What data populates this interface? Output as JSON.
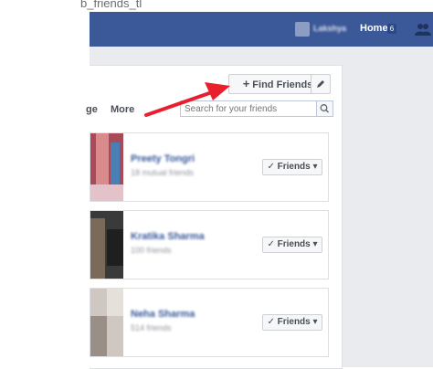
{
  "caption": "b_friends_tl",
  "topbar": {
    "username": "Lakshya",
    "home_label": "Home",
    "home_count": "6",
    "friend_requests_icon": "friend-requests-icon",
    "color": "#3b5998"
  },
  "toolbar": {
    "find_friends_label": "Find Friends",
    "find_friends_icon": "plus-icon",
    "edit_icon": "pencil-icon"
  },
  "tabs": {
    "partial_label": "ge",
    "more_label": "More"
  },
  "search": {
    "placeholder": "Search for your friends",
    "icon": "search-icon"
  },
  "friends": [
    {
      "name": "Preety Tongri",
      "meta": "18 mutual friends",
      "button_label": "Friends"
    },
    {
      "name": "Kratika Sharma",
      "meta": "100 friends",
      "button_label": "Friends"
    },
    {
      "name": "Neha Sharma",
      "meta": "514 friends",
      "button_label": "Friends"
    }
  ],
  "annotation": {
    "type": "arrow",
    "color": "#e8202e"
  }
}
